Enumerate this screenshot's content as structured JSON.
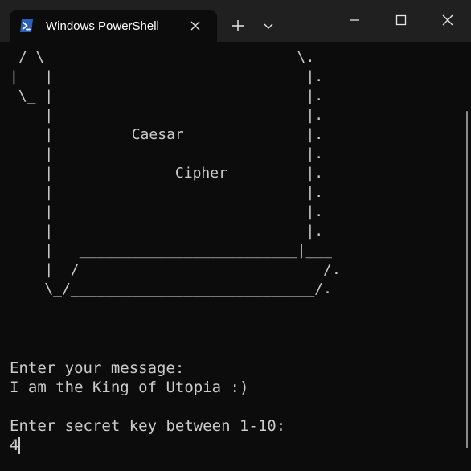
{
  "window": {
    "tab_title": "Windows PowerShell",
    "tab_icon": "powershell-icon",
    "buttons": {
      "new_tab": "plus-icon",
      "dropdown": "chevron-down-icon",
      "minimize": "minimize-icon",
      "maximize": "maximize-icon",
      "close": "close-icon"
    },
    "colors": {
      "titlebar": "#202020",
      "terminal_bg": "#0c0c0c",
      "terminal_text": "#cccccc",
      "powershell_blue": "#2b5fb8"
    }
  },
  "console": {
    "art_lines": [
      " / \\                             \\.",
      "|   |                             |.",
      " \\_ |                             |.",
      "    |                             |.",
      "    |         Caesar              |.",
      "    |                             |.",
      "    |              Cipher         |.",
      "    |                             |.",
      "    |                             |.",
      "    |                             |.",
      "    |   _________________________|___",
      "    |  /                            /.",
      "    \\_/____________________________/."
    ],
    "prompt_message": "Enter your message:",
    "message_value": "I am the King of Utopia :)",
    "prompt_key": "Enter secret key between 1-10:",
    "key_value": "4"
  }
}
